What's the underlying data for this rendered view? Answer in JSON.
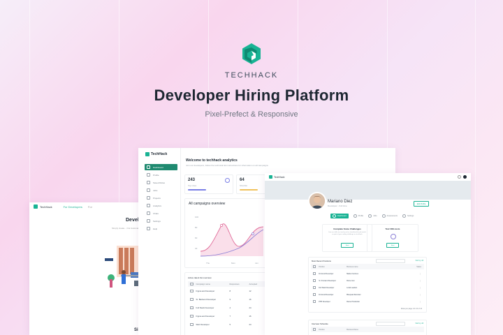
{
  "colors": {
    "brand": "#19b394",
    "accent_purple": "#7a7fe6",
    "accent_pink": "#e06a98",
    "dark": "#1e2732"
  },
  "hero": {
    "logo_icon": "techhack-hexagon-logo",
    "brand": "TECHHACK",
    "headline": "Developer Hiring Platform",
    "tagline": "Pixel-Prefect & Responsive"
  },
  "landing": {
    "brand": "TechHack",
    "nav_active": "For Developers",
    "nav_other": "For",
    "title": "Develope",
    "subtitle": "Simply create... Our Automated",
    "footer_heading": "Simp"
  },
  "dashboard": {
    "brand": "TechHack",
    "sidebar": [
      {
        "label": "Dashboard",
        "icon": "grid-icon",
        "active": true
      },
      {
        "label": "Profile",
        "icon": "user-icon",
        "active": false
      },
      {
        "label": "Saved Roles",
        "icon": "bookmark-icon",
        "active": false
      },
      {
        "label": "Jobs",
        "icon": "briefcase-icon",
        "active": false
      },
      {
        "label": "Projects",
        "icon": "folder-icon",
        "active": false
      },
      {
        "label": "Analytics",
        "icon": "chart-icon",
        "active": false
      },
      {
        "label": "Chats",
        "icon": "chat-icon",
        "active": false
      },
      {
        "label": "Settings",
        "icon": "gear-icon",
        "active": false
      },
      {
        "label": "Help",
        "icon": "help-icon",
        "active": false
      }
    ],
    "title": "Welcome to techhack analytics",
    "subtitle": "Join our developers, follow the technical link instructions for information on all campaigns",
    "stats": [
      {
        "value": "243",
        "label": "Top roles",
        "bar_color": "#7a7fe6"
      },
      {
        "value": "64",
        "label": "Shortlist",
        "bar_color": "#f0c25b"
      }
    ],
    "chart": {
      "title": "All campaigns overview",
      "x_labels": [
        "Thu",
        "Mon",
        "Jun"
      ],
      "y_labels": [
        "100",
        "80",
        "60",
        "40"
      ]
    },
    "table": {
      "title": "Active talent list overview",
      "headers": [
        "Campaign name",
        "Responses",
        "Accepted"
      ],
      "rows": [
        [
          "Figma and Developer",
          "8",
          "12"
        ],
        [
          "Sr. Backend Developer",
          "9",
          "16"
        ],
        [
          "Full Stack Developer",
          "4",
          "24"
        ],
        [
          "Figma and Developer",
          "7",
          "16"
        ],
        [
          "Web Developer",
          "5",
          "24"
        ]
      ]
    }
  },
  "profile": {
    "brand": "TechHack",
    "name": "Mariano Diez",
    "role": "Developer - Full time",
    "edit_label": "Edit Profile",
    "tabs": [
      {
        "label": "Dashboard",
        "active": true
      },
      {
        "label": "Profile",
        "active": false
      },
      {
        "label": "Jobs",
        "active": false
      },
      {
        "label": "Assessments",
        "active": false
      },
      {
        "label": "Settings",
        "active": false
      }
    ],
    "mini_cards": [
      {
        "title": "Complete Some Challenges",
        "desc": "Join our skills test and try to be shortlisted for job match as part of your coding challenge on techhack",
        "button": "Start"
      },
      {
        "title": "Test VMs tests",
        "desc": "",
        "button": "Start"
      }
    ],
    "table1": {
      "title": "Most Recent Positions",
      "filter": "Sort by: All",
      "headers": [
        "Position",
        "Business name",
        "Status"
      ],
      "rows": [
        [
          "Frontend Developer",
          "Market Invoices"
        ],
        [
          "Sr. Frontend Developer",
          "Rome Gov"
        ],
        [
          "Full Stack Developer",
          "Local Leaders"
        ],
        [
          "Frontend Developer",
          "Bluepeak Recruiter"
        ],
        [
          "PHP Developer",
          "Flame Production"
        ]
      ],
      "pagination": "Rows per page: 10  1-5 of 13"
    },
    "table2": {
      "title": "Interview Schedule",
      "filter": "Sort by: All",
      "headers": [
        "Position",
        "Business Name"
      ]
    }
  }
}
